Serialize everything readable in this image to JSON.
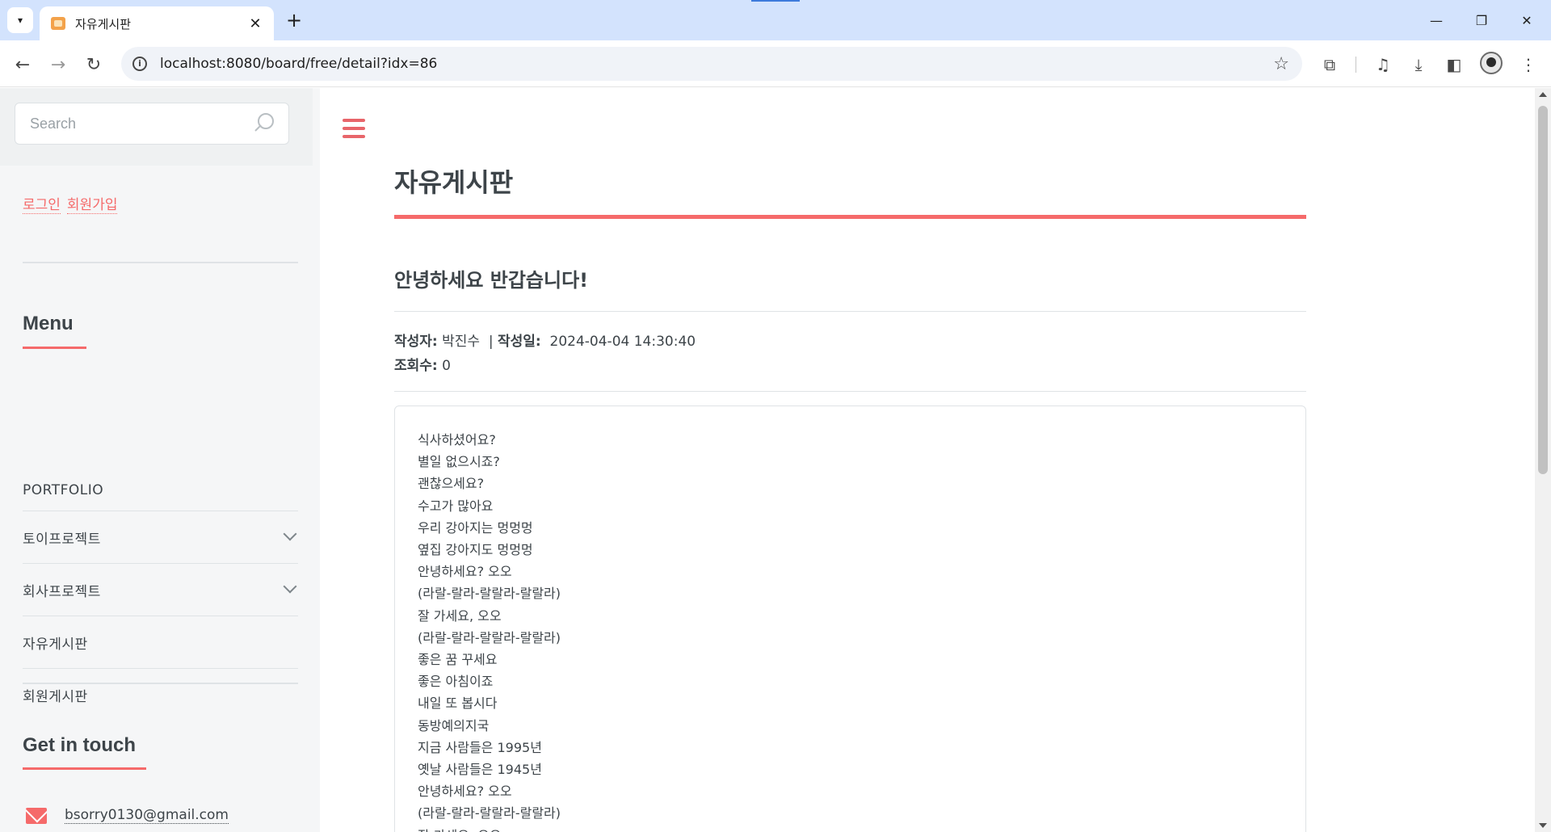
{
  "browser": {
    "tab_title": "자유게시판",
    "url": "localhost:8080/board/free/detail?idx=86"
  },
  "sidebar": {
    "search_placeholder": "Search",
    "auth": {
      "login": "로그인",
      "signup": "회원가입"
    },
    "menu_heading": "Menu",
    "menu_items": [
      {
        "label": "PORTFOLIO",
        "expandable": false
      },
      {
        "label": "토이프로젝트",
        "expandable": true
      },
      {
        "label": "회사프로젝트",
        "expandable": true
      },
      {
        "label": "자유게시판",
        "expandable": false
      },
      {
        "label": "회원게시판",
        "expandable": false
      }
    ],
    "contact_heading": "Get in touch",
    "email": "bsorry0130@gmail.com"
  },
  "main": {
    "board_title": "자유게시판",
    "post_title": "안녕하세요 반갑습니다!",
    "meta": {
      "author_label": "작성자:",
      "author": "박진수",
      "separator": "|",
      "date_label": "작성일:",
      "date": "2024-04-04 14:30:40",
      "views_label": "조회수:",
      "views": "0"
    },
    "content_lines": [
      "식사하셨어요?",
      "별일 없으시죠?",
      "괜찮으세요?",
      "수고가 많아요",
      "우리 강아지는 멍멍멍",
      "옆집 강아지도 멍멍멍",
      "안녕하세요? 오오",
      "(라랄-랄라-랄랄라-랄랄라)",
      "잘 가세요, 오오",
      "(라랄-랄라-랄랄라-랄랄라)",
      "좋은 꿈 꾸세요",
      "좋은 아침이죠",
      "내일 또 봅시다",
      "동방예의지국",
      "지금 사람들은 1995년",
      "옛날 사람들은 1945년",
      "안녕하세요? 오오",
      "(라랄-랄라-랄랄라-랄랄라)",
      "잘 가세요, 오오"
    ]
  },
  "colors": {
    "accent": "#f56a6a",
    "text": "#3d4449",
    "border": "#dfe3e6",
    "sidebar_bg": "#f5f6f7",
    "chrome_tabbar": "#d3e3fd"
  }
}
